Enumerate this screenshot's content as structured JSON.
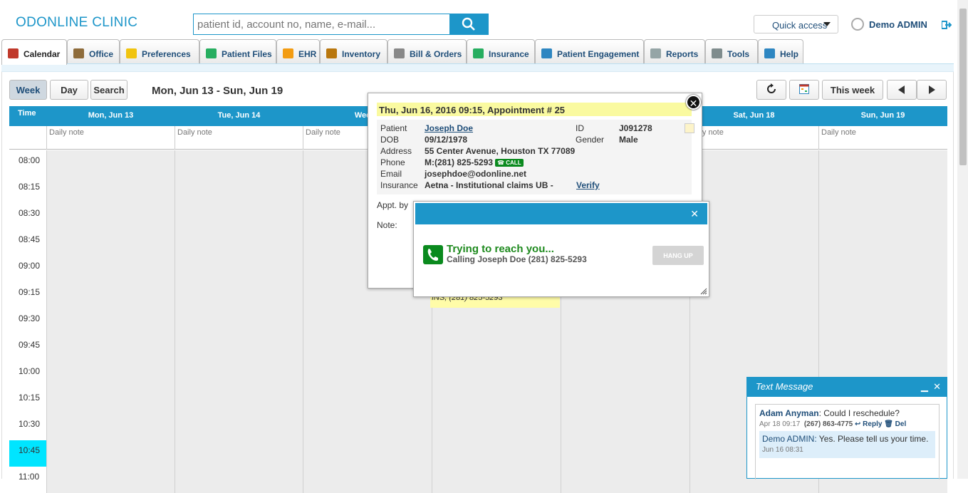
{
  "app": {
    "title": "ODONLINE CLINIC"
  },
  "search": {
    "placeholder": "patient id, account no, name, e-mail..."
  },
  "quick_access": "Quick access",
  "user": "Demo ADMIN",
  "tabs": [
    {
      "label": "Calendar",
      "icon": "calendar-icon",
      "color": "#c0392b"
    },
    {
      "label": "Office",
      "icon": "home-icon",
      "color": "#8e6b3a"
    },
    {
      "label": "Preferences",
      "icon": "edit-icon",
      "color": "#f1c40f"
    },
    {
      "label": "Patient Files",
      "icon": "folder-icon",
      "color": "#27ae60"
    },
    {
      "label": "EHR",
      "icon": "lightning-icon",
      "color": "#f39c12"
    },
    {
      "label": "Inventory",
      "icon": "box-icon",
      "color": "#b9770e"
    },
    {
      "label": "Bill & Orders",
      "icon": "cart-icon",
      "color": "#888888"
    },
    {
      "label": "Insurance",
      "icon": "money-icon",
      "color": "#27ae60"
    },
    {
      "label": "Patient Engagement",
      "icon": "globe-icon",
      "color": "#2e86c1"
    },
    {
      "label": "Reports",
      "icon": "report-icon",
      "color": "#95a5a6"
    },
    {
      "label": "Tools",
      "icon": "wrench-icon",
      "color": "#7f8c8d"
    },
    {
      "label": "Help",
      "icon": "help-icon",
      "color": "#2e86c1"
    }
  ],
  "toolbar": {
    "week": "Week",
    "day": "Day",
    "search": "Search",
    "range": "Mon, Jun 13 - Sun, Jun 19",
    "this_week": "This week"
  },
  "grid": {
    "time_label": "Time",
    "days": [
      "Mon, Jun 13",
      "Tue, Jun 14",
      "Wed, J",
      "",
      "",
      "Sat, Jun 18",
      "Sun, Jun 19"
    ],
    "daily_note": "Daily note",
    "daily_note_partial": "ily note",
    "times": [
      "08:00",
      "08:15",
      "08:30",
      "08:45",
      "09:00",
      "09:15",
      "09:30",
      "09:45",
      "10:00",
      "10:15",
      "10:30",
      "10:45",
      "11:00"
    ],
    "current_time": "10:45"
  },
  "appointment_snippet": "INS, (281) 825-5293",
  "appt_popup": {
    "title": "Thu, Jun 16, 2016 09:15, Appointment # 25",
    "labels": {
      "patient": "Patient",
      "dob": "DOB",
      "address": "Address",
      "phone": "Phone",
      "email": "Email",
      "insurance": "Insurance",
      "id": "ID",
      "gender": "Gender",
      "appt_by": "Appt. by",
      "note": "Note:"
    },
    "patient": "Joseph Doe",
    "dob": "09/12/1978",
    "address": "55 Center Avenue, Houston TX 77089",
    "phone": "M:(281) 825-5293",
    "call": "CALL",
    "email": "josephdoe@odonline.net",
    "insurance": "Aetna - Institutional claims UB -",
    "verify": "Verify",
    "id": "J091278",
    "gender": "Male"
  },
  "call_dialog": {
    "trying": "Trying to reach you...",
    "calling": "Calling Joseph Doe (281) 825-5293",
    "hangup": "HANG UP"
  },
  "text_message": {
    "title": "Text Message",
    "sender": "Adam Anyman",
    "message": ": Could I reschedule?",
    "time": "Apr 18 09:17",
    "phone": "(267) 863-4775",
    "reply": "Reply",
    "del": "Del",
    "reply_author": "Demo ADMIN:",
    "reply_text": " Yes. Please tell us your time.",
    "reply_time": "Jun 16 08:31"
  }
}
